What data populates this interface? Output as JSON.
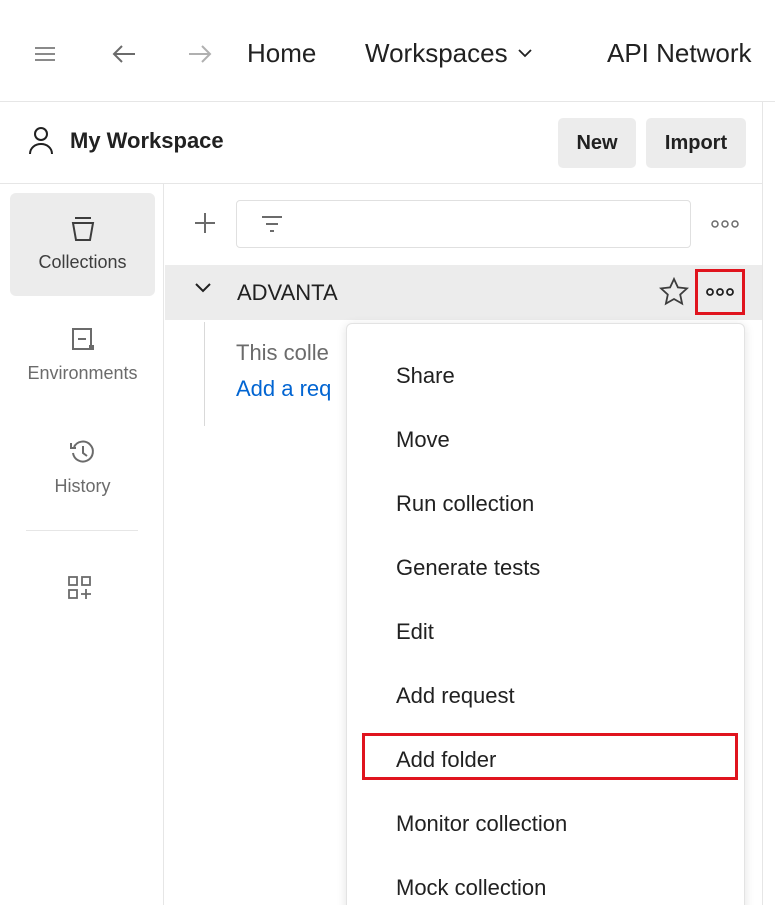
{
  "header": {
    "home": "Home",
    "workspaces": "Workspaces",
    "api_network": "API Network",
    "menu_icon": "hamburger-icon",
    "back_icon": "arrow-left-icon",
    "forward_icon": "arrow-right-icon"
  },
  "workspace": {
    "title": "My Workspace",
    "new_label": "New",
    "import_label": "Import"
  },
  "rail": {
    "items": [
      {
        "label": "Collections",
        "icon": "collections-icon",
        "active": true
      },
      {
        "label": "Environments",
        "icon": "environments-icon",
        "active": false
      },
      {
        "label": "History",
        "icon": "history-icon",
        "active": false
      }
    ],
    "configure_icon": "add-workbench-icon"
  },
  "collection": {
    "name": "ADVANTA",
    "empty_text": "This colle",
    "add_request_link": "Add a req"
  },
  "context_menu": {
    "items": [
      "Share",
      "Move",
      "Run collection",
      "Generate tests",
      "Edit",
      "Add request",
      "Add folder",
      "Monitor collection",
      "Mock collection"
    ],
    "highlighted": "Add folder"
  },
  "colors": {
    "highlight": "#e0141e",
    "link": "#0265d2",
    "active_bg": "#ececec"
  }
}
